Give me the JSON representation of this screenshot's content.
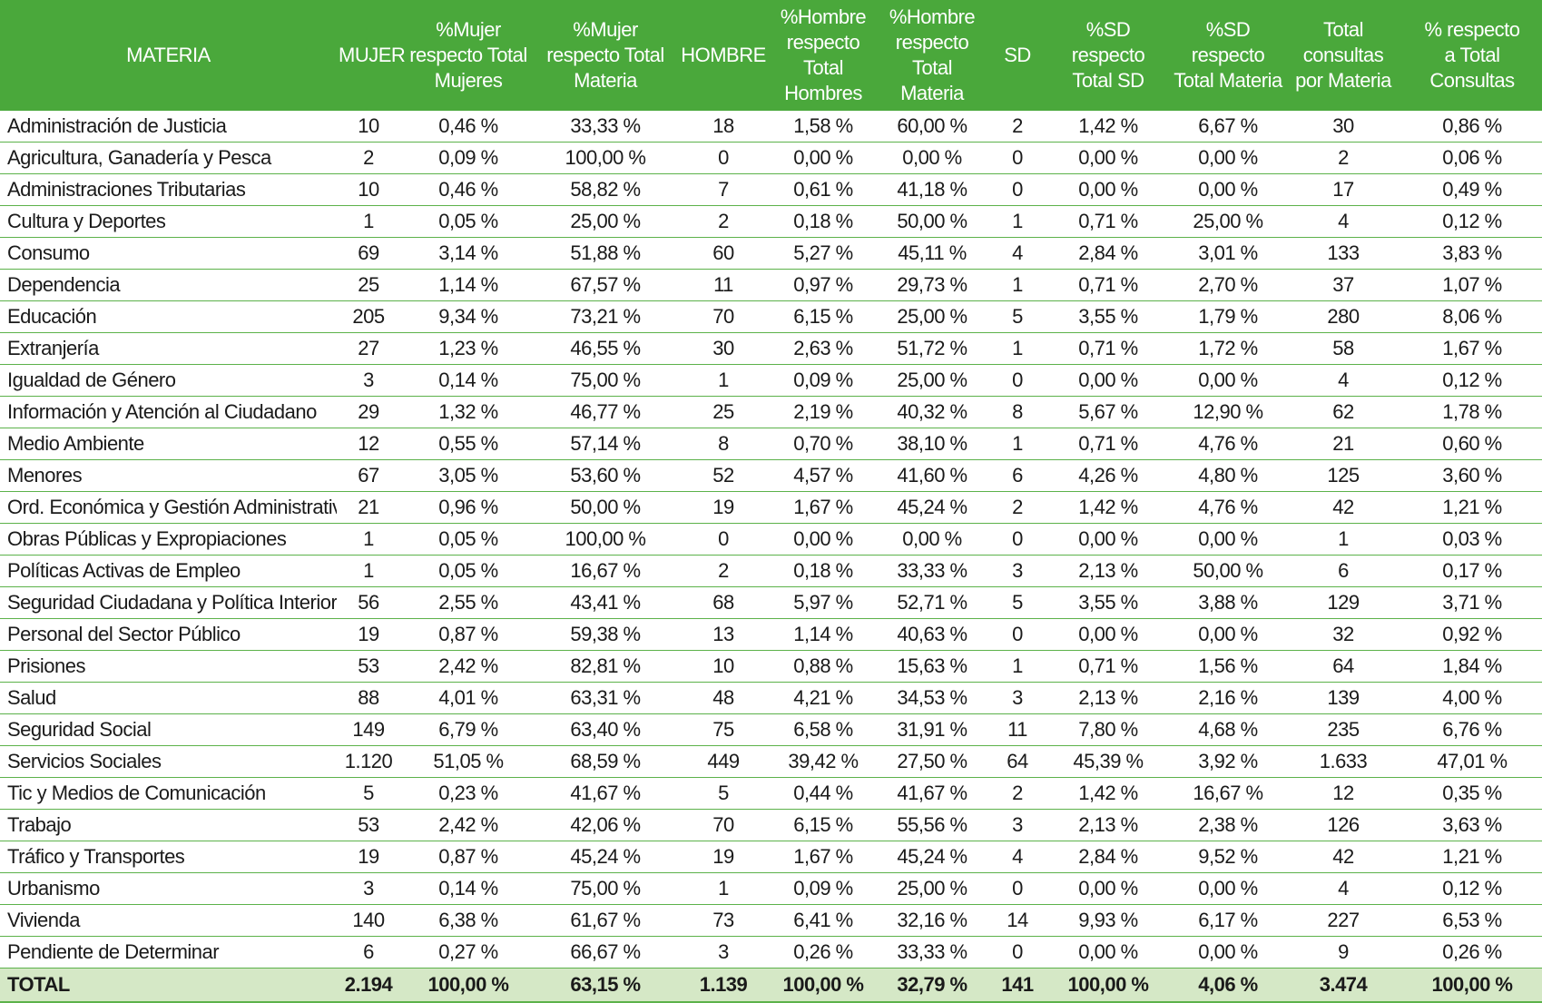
{
  "headers": [
    "MATERIA",
    "MUJER",
    "%Mujer\nrespecto Total\nMujeres",
    "%Mujer\nrespecto Total\nMateria",
    "HOMBRE",
    "%Hombre\nrespecto\nTotal\nHombres",
    "%Hombre\nrespecto\nTotal\nMateria",
    "SD",
    "%SD\nrespecto\nTotal SD",
    "%SD\nrespecto\nTotal Materia",
    "Total\nconsultas\npor Materia",
    "% respecto\na Total\nConsultas"
  ],
  "rows": [
    [
      "Administración de Justicia",
      "10",
      "0,46 %",
      "33,33 %",
      "18",
      "1,58 %",
      "60,00 %",
      "2",
      "1,42 %",
      "6,67 %",
      "30",
      "0,86 %"
    ],
    [
      "Agricultura, Ganadería y Pesca",
      "2",
      "0,09 %",
      "100,00 %",
      "0",
      "0,00 %",
      "0,00 %",
      "0",
      "0,00 %",
      "0,00 %",
      "2",
      "0,06 %"
    ],
    [
      "Administraciones Tributarias",
      "10",
      "0,46 %",
      "58,82 %",
      "7",
      "0,61 %",
      "41,18 %",
      "0",
      "0,00 %",
      "0,00 %",
      "17",
      "0,49 %"
    ],
    [
      "Cultura y Deportes",
      "1",
      "0,05 %",
      "25,00 %",
      "2",
      "0,18 %",
      "50,00 %",
      "1",
      "0,71 %",
      "25,00 %",
      "4",
      "0,12 %"
    ],
    [
      "Consumo",
      "69",
      "3,14 %",
      "51,88 %",
      "60",
      "5,27 %",
      "45,11 %",
      "4",
      "2,84 %",
      "3,01 %",
      "133",
      "3,83 %"
    ],
    [
      "Dependencia",
      "25",
      "1,14 %",
      "67,57 %",
      "11",
      "0,97 %",
      "29,73 %",
      "1",
      "0,71 %",
      "2,70 %",
      "37",
      "1,07 %"
    ],
    [
      "Educación",
      "205",
      "9,34 %",
      "73,21 %",
      "70",
      "6,15 %",
      "25,00 %",
      "5",
      "3,55 %",
      "1,79 %",
      "280",
      "8,06 %"
    ],
    [
      "Extranjería",
      "27",
      "1,23 %",
      "46,55 %",
      "30",
      "2,63 %",
      "51,72 %",
      "1",
      "0,71 %",
      "1,72 %",
      "58",
      "1,67 %"
    ],
    [
      "Igualdad de Género",
      "3",
      "0,14 %",
      "75,00 %",
      "1",
      "0,09 %",
      "25,00 %",
      "0",
      "0,00 %",
      "0,00 %",
      "4",
      "0,12 %"
    ],
    [
      "Información y Atención al Ciudadano",
      "29",
      "1,32 %",
      "46,77 %",
      "25",
      "2,19 %",
      "40,32 %",
      "8",
      "5,67 %",
      "12,90 %",
      "62",
      "1,78 %"
    ],
    [
      "Medio Ambiente",
      "12",
      "0,55 %",
      "57,14 %",
      "8",
      "0,70 %",
      "38,10 %",
      "1",
      "0,71 %",
      "4,76 %",
      "21",
      "0,60 %"
    ],
    [
      "Menores",
      "67",
      "3,05 %",
      "53,60 %",
      "52",
      "4,57 %",
      "41,60 %",
      "6",
      "4,26 %",
      "4,80 %",
      "125",
      "3,60 %"
    ],
    [
      "Ord. Económica y Gestión Administrativa",
      "21",
      "0,96 %",
      "50,00 %",
      "19",
      "1,67 %",
      "45,24 %",
      "2",
      "1,42 %",
      "4,76 %",
      "42",
      "1,21 %"
    ],
    [
      "Obras Públicas y Expropiaciones",
      "1",
      "0,05 %",
      "100,00 %",
      "0",
      "0,00 %",
      "0,00 %",
      "0",
      "0,00 %",
      "0,00 %",
      "1",
      "0,03 %"
    ],
    [
      "Políticas Activas de Empleo",
      "1",
      "0,05 %",
      "16,67 %",
      "2",
      "0,18 %",
      "33,33 %",
      "3",
      "2,13 %",
      "50,00 %",
      "6",
      "0,17 %"
    ],
    [
      "Seguridad Ciudadana y Política Interior",
      "56",
      "2,55 %",
      "43,41 %",
      "68",
      "5,97 %",
      "52,71 %",
      "5",
      "3,55 %",
      "3,88 %",
      "129",
      "3,71 %"
    ],
    [
      "Personal del Sector Público",
      "19",
      "0,87 %",
      "59,38 %",
      "13",
      "1,14 %",
      "40,63 %",
      "0",
      "0,00 %",
      "0,00 %",
      "32",
      "0,92 %"
    ],
    [
      "Prisiones",
      "53",
      "2,42 %",
      "82,81 %",
      "10",
      "0,88 %",
      "15,63 %",
      "1",
      "0,71 %",
      "1,56 %",
      "64",
      "1,84 %"
    ],
    [
      "Salud",
      "88",
      "4,01 %",
      "63,31 %",
      "48",
      "4,21 %",
      "34,53 %",
      "3",
      "2,13 %",
      "2,16 %",
      "139",
      "4,00 %"
    ],
    [
      "Seguridad Social",
      "149",
      "6,79 %",
      "63,40 %",
      "75",
      "6,58 %",
      "31,91 %",
      "11",
      "7,80 %",
      "4,68 %",
      "235",
      "6,76 %"
    ],
    [
      "Servicios Sociales",
      "1.120",
      "51,05 %",
      "68,59 %",
      "449",
      "39,42 %",
      "27,50 %",
      "64",
      "45,39 %",
      "3,92 %",
      "1.633",
      "47,01 %"
    ],
    [
      "Tic y Medios de Comunicación",
      "5",
      "0,23 %",
      "41,67 %",
      "5",
      "0,44 %",
      "41,67 %",
      "2",
      "1,42 %",
      "16,67 %",
      "12",
      "0,35 %"
    ],
    [
      "Trabajo",
      "53",
      "2,42 %",
      "42,06 %",
      "70",
      "6,15 %",
      "55,56 %",
      "3",
      "2,13 %",
      "2,38 %",
      "126",
      "3,63 %"
    ],
    [
      "Tráfico y Transportes",
      "19",
      "0,87 %",
      "45,24 %",
      "19",
      "1,67 %",
      "45,24 %",
      "4",
      "2,84 %",
      "9,52 %",
      "42",
      "1,21 %"
    ],
    [
      "Urbanismo",
      "3",
      "0,14 %",
      "75,00 %",
      "1",
      "0,09 %",
      "25,00 %",
      "0",
      "0,00 %",
      "0,00 %",
      "4",
      "0,12 %"
    ],
    [
      "Vivienda",
      "140",
      "6,38 %",
      "61,67 %",
      "73",
      "6,41 %",
      "32,16 %",
      "14",
      "9,93 %",
      "6,17 %",
      "227",
      "6,53 %"
    ],
    [
      "Pendiente de Determinar",
      "6",
      "0,27 %",
      "66,67 %",
      "3",
      "0,26 %",
      "33,33 %",
      "0",
      "0,00 %",
      "0,00 %",
      "9",
      "0,26 %"
    ]
  ],
  "total": [
    "TOTAL",
    "2.194",
    "100,00 %",
    "63,15 %",
    "1.139",
    "100,00 %",
    "32,79 %",
    "141",
    "100,00 %",
    "4,06 %",
    "3.474",
    "100,00 %"
  ],
  "colors": {
    "header_bg": "#4aa83b",
    "rule": "#5cb24a",
    "total_bg": "#d5e8c6"
  }
}
